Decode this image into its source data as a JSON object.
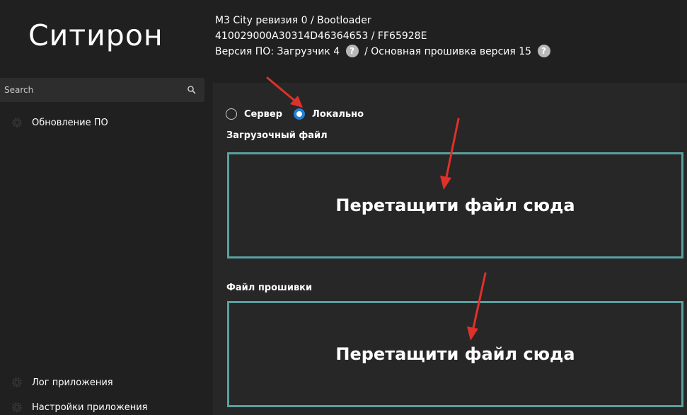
{
  "app": {
    "title": "Ситирон"
  },
  "device_info": {
    "line1": "M3 City ревизия 0 / Bootloader",
    "line2": "410029000A30314D46364653 / FF65928E",
    "line3_prefix": "Версия ПО: Загрузчик 4",
    "line3_suffix": "/ Основная прошивка версия 15",
    "help_glyph": "?"
  },
  "sidebar": {
    "search": {
      "placeholder": "Search",
      "value": ""
    },
    "items": [
      {
        "label": "Обновление ПО",
        "icon": "gear-icon"
      },
      {
        "label": "Лог приложения",
        "icon": "gear-icon"
      },
      {
        "label": "Настройки приложения",
        "icon": "gear-icon"
      }
    ]
  },
  "main": {
    "source_options": [
      {
        "label": "Сервер",
        "selected": false
      },
      {
        "label": "Локально",
        "selected": true
      }
    ],
    "bootloader_label": "Загрузочный файл",
    "bootloader_drop_text": "Перетащити файл сюда",
    "firmware_label": "Файл прошивки",
    "firmware_drop_text": "Перетащити файл сюда"
  },
  "colors": {
    "background": "#202020",
    "panel": "#272727",
    "accent_radio": "#1f80d8",
    "drop_border": "#5aa09f",
    "annotation_arrow": "#e0302a"
  }
}
